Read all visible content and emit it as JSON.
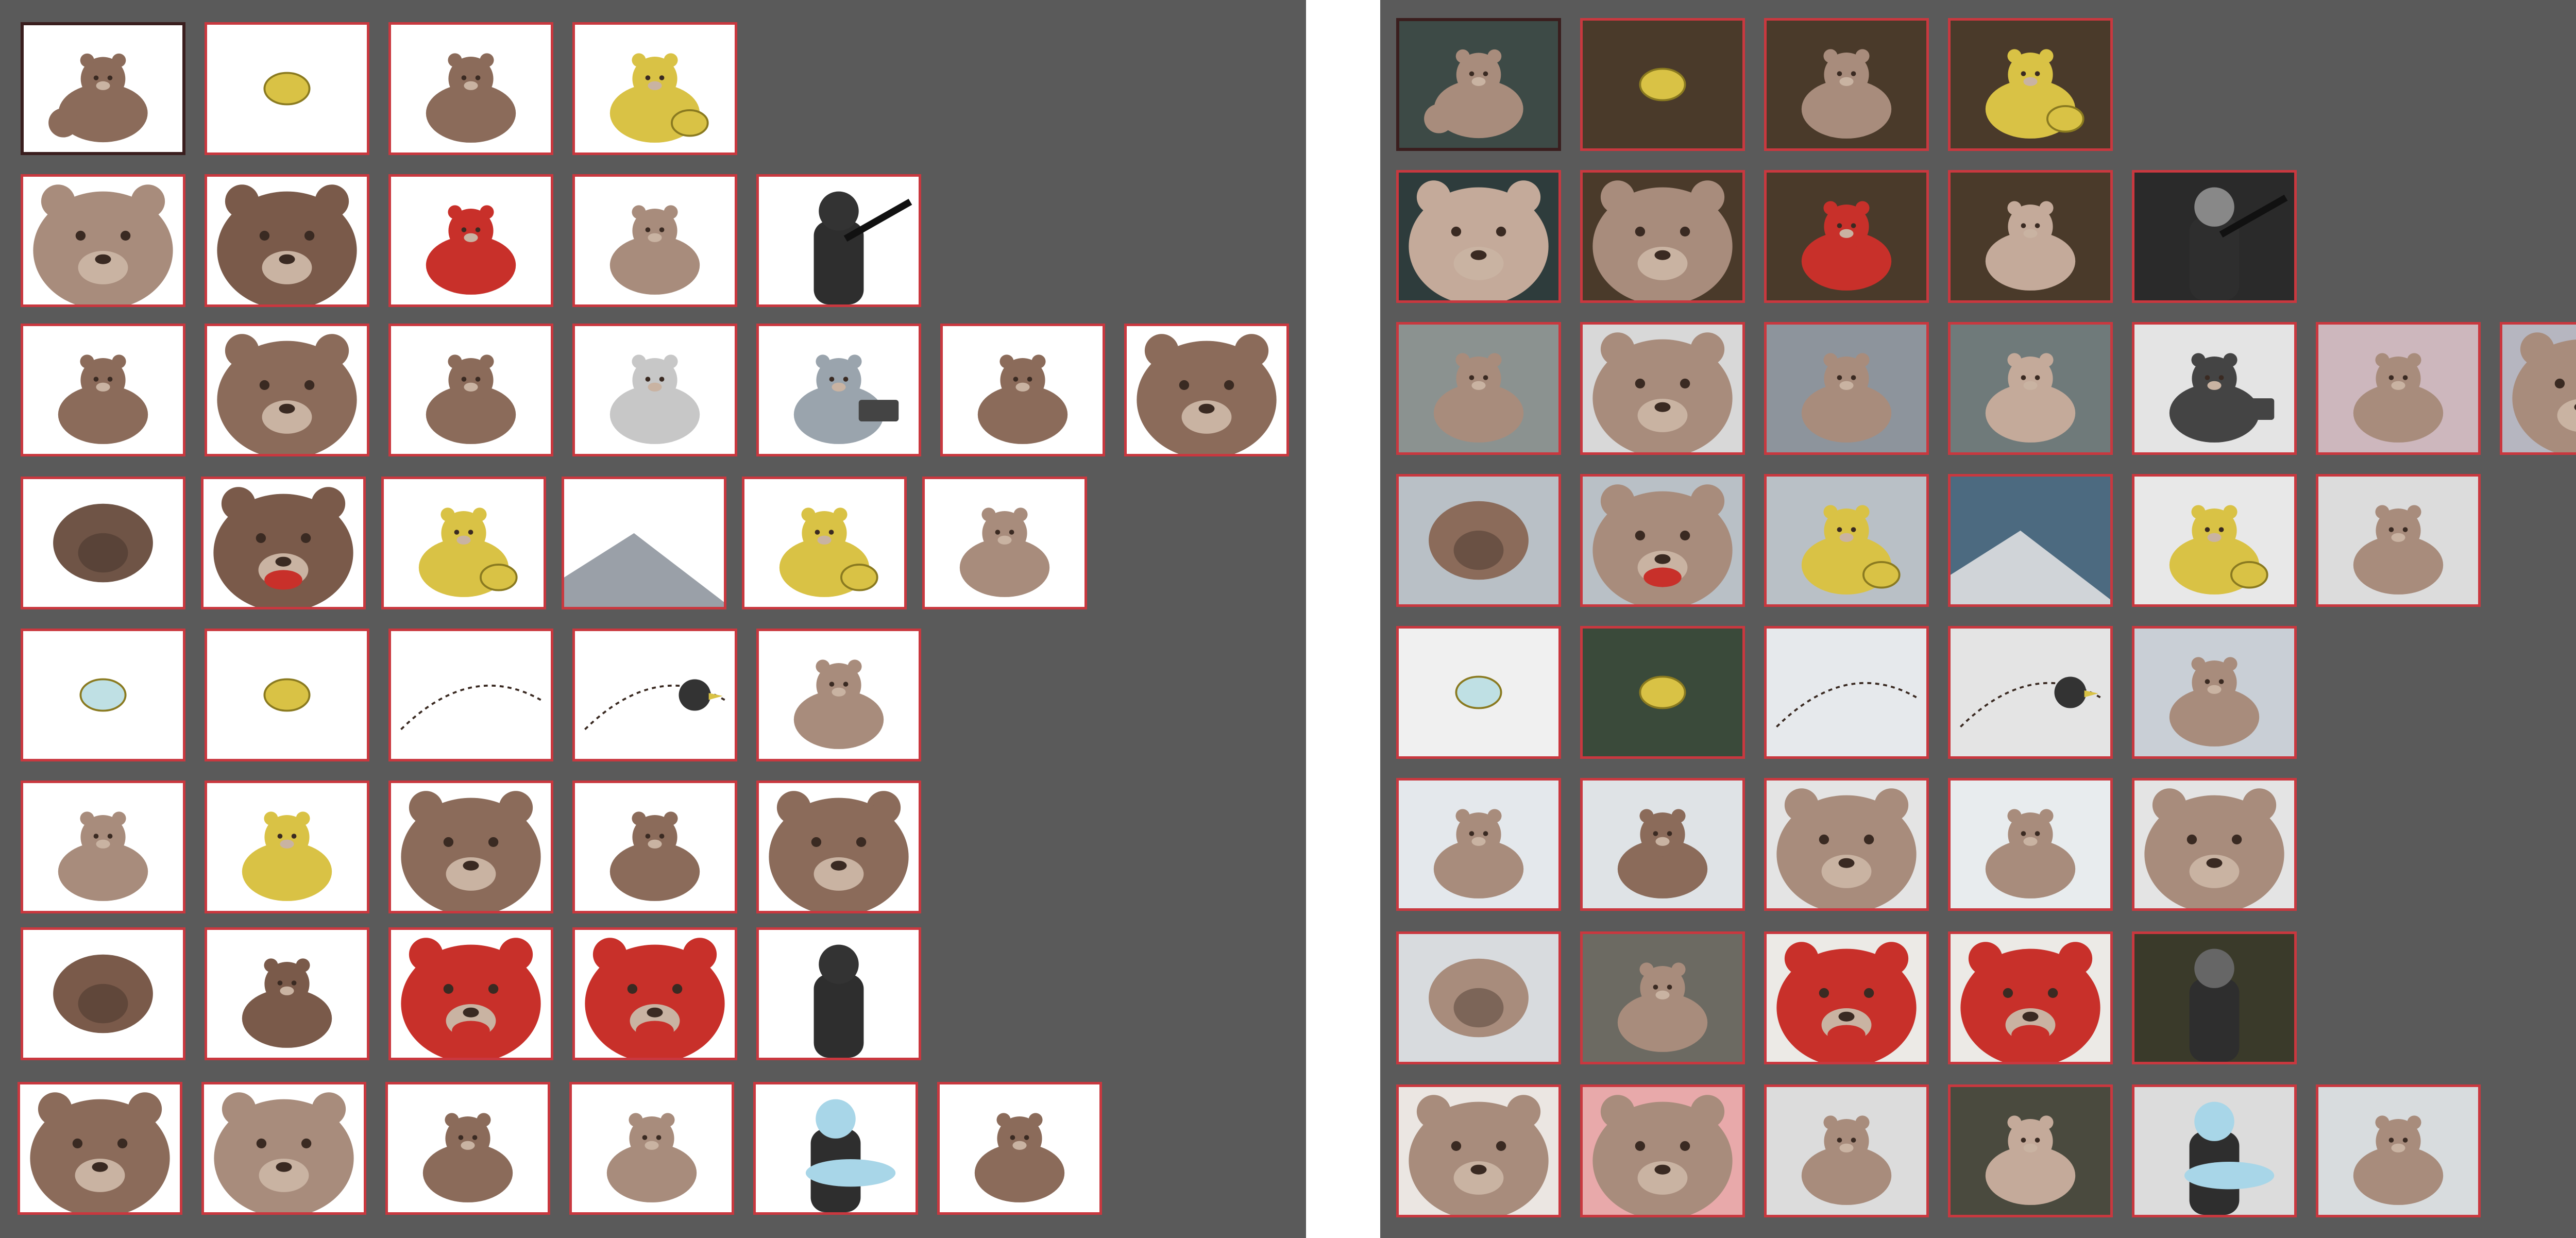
{
  "panels": [
    {
      "id": "storyboard-left",
      "selected_frame": "1-1",
      "rows": [
        [
          {
            "icon": "bear-and-cub-icon",
            "bg": "#ffffff",
            "accent": "#8b6b5a"
          },
          {
            "icon": "squirrel-and-honey-icon",
            "bg": "#ffffff",
            "accent": "#d9c245"
          },
          {
            "icon": "bear-walking-icon",
            "bg": "#ffffff",
            "accent": "#8b6b5a"
          },
          {
            "icon": "bear-eating-honey-icon",
            "bg": "#ffffff",
            "accent": "#d9c245"
          }
        ],
        [
          {
            "icon": "worried-bear-face-icon",
            "bg": "#ffffff",
            "accent": "#a88c7c"
          },
          {
            "icon": "angry-bear-eyes-icon",
            "bg": "#ffffff",
            "accent": "#7a5a4a"
          },
          {
            "icon": "injured-bear-icon",
            "bg": "#ffffff",
            "accent": "#c8302a"
          },
          {
            "icon": "bears-fighting-icon",
            "bg": "#ffffff",
            "accent": "#a88c7c"
          },
          {
            "icon": "hunter-with-rifle-icon",
            "bg": "#ffffff",
            "accent": "#333333"
          }
        ],
        [
          {
            "icon": "roaring-bear-icon",
            "bg": "#ffffff",
            "accent": "#8b6b5a"
          },
          {
            "icon": "bear-head-closeup-icon",
            "bg": "#ffffff",
            "accent": "#8b6b5a"
          },
          {
            "icon": "shocked-bear-icon",
            "bg": "#ffffff",
            "accent": "#8b6b5a"
          },
          {
            "icon": "bear-on-slope-icon",
            "bg": "#ffffff",
            "accent": "#c7c7c7"
          },
          {
            "icon": "bear-and-truck-icon",
            "bg": "#ffffff",
            "accent": "#9aa4ad"
          },
          {
            "icon": "small-bear-in-snow-icon",
            "bg": "#ffffff",
            "accent": "#8b6b5a"
          },
          {
            "icon": "grumpy-bear-face-icon",
            "bg": "#ffffff",
            "accent": "#8b6b5a"
          }
        ],
        [
          {
            "icon": "bear-paw-icon",
            "bg": "#ffffff",
            "accent": "#6f5446"
          },
          {
            "icon": "bear-teeth-icon",
            "bg": "#ffffff",
            "accent": "#7a5a4a"
          },
          {
            "icon": "bear-holding-honey-icon",
            "bg": "#ffffff",
            "accent": "#d9c245"
          },
          {
            "icon": "mountain-slope-icon",
            "bg": "#ffffff",
            "accent": "#9aa0a8"
          },
          {
            "icon": "bear-with-honey-icon",
            "bg": "#ffffff",
            "accent": "#d9c245"
          },
          {
            "icon": "bear-on-rock-icon",
            "bg": "#ffffff",
            "accent": "#a88c7c"
          }
        ],
        [
          {
            "icon": "paw-with-honey-icon",
            "bg": "#ffffff",
            "accent": "#bfe0e4"
          },
          {
            "icon": "honey-falling-icon",
            "bg": "#ffffff",
            "accent": "#d9c245"
          },
          {
            "icon": "dotted-arc-icon",
            "bg": "#ffffff",
            "accent": "#444444"
          },
          {
            "icon": "bird-flying-icon",
            "bg": "#ffffff",
            "accent": "#333333"
          },
          {
            "icon": "bear-arms-crossed-icon",
            "bg": "#ffffff",
            "accent": "#a88c7c"
          }
        ],
        [
          {
            "icon": "bear-dancing-icon",
            "bg": "#ffffff",
            "accent": "#a88c7c"
          },
          {
            "icon": "claw-strike-icon",
            "bg": "#ffffff",
            "accent": "#d9c245"
          },
          {
            "icon": "bear-growling-icon",
            "bg": "#ffffff",
            "accent": "#8b6b5a"
          },
          {
            "icon": "tiny-bear-icon",
            "bg": "#ffffff",
            "accent": "#8b6b5a"
          },
          {
            "icon": "crying-bear-icon",
            "bg": "#ffffff",
            "accent": "#8b6b5a"
          }
        ],
        [
          {
            "icon": "bear-paws-stomp-icon",
            "bg": "#ffffff",
            "accent": "#7a5a4a"
          },
          {
            "icon": "bear-standing-roar-icon",
            "bg": "#ffffff",
            "accent": "#7a5a4a"
          },
          {
            "icon": "bear-open-mouth-icon",
            "bg": "#ffffff",
            "accent": "#c8302a"
          },
          {
            "icon": "bear-side-roar-icon",
            "bg": "#ffffff",
            "accent": "#c8302a"
          },
          {
            "icon": "hooded-figure-icon",
            "bg": "#ffffff",
            "accent": "#333333"
          }
        ],
        [
          {
            "icon": "bear-peeking-icon",
            "bg": "#ffffff",
            "accent": "#8b6b5a"
          },
          {
            "icon": "bear-covering-eye-icon",
            "bg": "#ffffff",
            "accent": "#a88c7c"
          },
          {
            "icon": "bear-cheering-icon",
            "bg": "#ffffff",
            "accent": "#8b6b5a"
          },
          {
            "icon": "bear-walking-away-icon",
            "bg": "#ffffff",
            "accent": "#a88c7c"
          },
          {
            "icon": "figure-with-fish-icon",
            "bg": "#ffffff",
            "accent": "#a8d6e8"
          },
          {
            "icon": "bear-back-view-icon",
            "bg": "#ffffff",
            "accent": "#8b6b5a"
          }
        ]
      ]
    },
    {
      "id": "storyboard-right",
      "selected_frame": "1-1",
      "rows": [
        [
          {
            "icon": "bear-and-cub-icon",
            "bg": "#3d4a46",
            "accent": "#a88c7c"
          },
          {
            "icon": "squirrel-and-honey-icon",
            "bg": "#4a3a2a",
            "accent": "#d9c245"
          },
          {
            "icon": "bear-walking-icon",
            "bg": "#4a3a2a",
            "accent": "#a88c7c"
          },
          {
            "icon": "bear-eating-honey-icon",
            "bg": "#4a3a2a",
            "accent": "#d9c245"
          }
        ],
        [
          {
            "icon": "worried-bear-face-icon",
            "bg": "#2e3c3c",
            "accent": "#c4aa9a"
          },
          {
            "icon": "angry-bear-eyes-icon",
            "bg": "#4a3a2a",
            "accent": "#a88c7c"
          },
          {
            "icon": "injured-bear-icon",
            "bg": "#4a3a2a",
            "accent": "#c8302a"
          },
          {
            "icon": "bears-fighting-icon",
            "bg": "#4a3a2a",
            "accent": "#c4aa9a"
          },
          {
            "icon": "hunter-with-rifle-icon",
            "bg": "#2a2a2a",
            "accent": "#888888"
          }
        ],
        [
          {
            "icon": "roaring-bear-icon",
            "bg": "#8b9290",
            "accent": "#a88c7c"
          },
          {
            "icon": "bear-head-closeup-icon",
            "bg": "#d8d8d8",
            "accent": "#a88c7c"
          },
          {
            "icon": "shocked-bear-icon",
            "bg": "#8d949c",
            "accent": "#a88c7c"
          },
          {
            "icon": "bear-on-slope-icon",
            "bg": "#6f7a7a",
            "accent": "#c4aa9a"
          },
          {
            "icon": "bear-and-truck-icon",
            "bg": "#e4e4e4",
            "accent": "#444444"
          },
          {
            "icon": "small-bear-in-snow-icon",
            "bg": "#cdb7bd",
            "accent": "#a88c7c"
          },
          {
            "icon": "grumpy-bear-face-icon",
            "bg": "#b6b6c0",
            "accent": "#a88c7c"
          }
        ],
        [
          {
            "icon": "bear-paw-icon",
            "bg": "#b9c0c6",
            "accent": "#8b6b5a"
          },
          {
            "icon": "bear-teeth-icon",
            "bg": "#b9c0c6",
            "accent": "#a88c7c"
          },
          {
            "icon": "bear-holding-honey-icon",
            "bg": "#b9c0c6",
            "accent": "#d9c245"
          },
          {
            "icon": "mountain-slope-icon",
            "bg": "#4c6a80",
            "accent": "#d0d4d8"
          },
          {
            "icon": "bear-with-honey-icon",
            "bg": "#e8e8e8",
            "accent": "#d9c245"
          },
          {
            "icon": "bear-on-rock-icon",
            "bg": "#dcdcdc",
            "accent": "#a88c7c"
          }
        ],
        [
          {
            "icon": "paw-with-honey-icon",
            "bg": "#f0f0f0",
            "accent": "#bfe0e4"
          },
          {
            "icon": "honey-falling-icon",
            "bg": "#3a4a3a",
            "accent": "#d9c245"
          },
          {
            "icon": "dotted-arc-icon",
            "bg": "#e6e9ec",
            "accent": "#9aa4ad"
          },
          {
            "icon": "bird-flying-icon",
            "bg": "#e4e4e4",
            "accent": "#333333"
          },
          {
            "icon": "bear-arms-crossed-icon",
            "bg": "#c9cfd6",
            "accent": "#a88c7c"
          }
        ],
        [
          {
            "icon": "bear-dancing-icon",
            "bg": "#e4e8ec",
            "accent": "#a88c7c"
          },
          {
            "icon": "claw-strike-icon",
            "bg": "#dfe3e6",
            "accent": "#8b6b5a"
          },
          {
            "icon": "bear-growling-icon",
            "bg": "#e4e4e4",
            "accent": "#a88c7c"
          },
          {
            "icon": "tiny-bear-icon",
            "bg": "#e8ecee",
            "accent": "#a88c7c"
          },
          {
            "icon": "crying-bear-icon",
            "bg": "#e4e4e4",
            "accent": "#a88c7c"
          }
        ],
        [
          {
            "icon": "bear-paws-stomp-icon",
            "bg": "#d8dbde",
            "accent": "#a88c7c"
          },
          {
            "icon": "bear-standing-roar-icon",
            "bg": "#6c6a62",
            "accent": "#a88c7c"
          },
          {
            "icon": "bear-open-mouth-icon",
            "bg": "#eceae6",
            "accent": "#c8302a"
          },
          {
            "icon": "bear-side-roar-icon",
            "bg": "#eceae6",
            "accent": "#c8302a"
          },
          {
            "icon": "hooded-figure-icon",
            "bg": "#3a3a2a",
            "accent": "#666666"
          }
        ],
        [
          {
            "icon": "bear-peeking-icon",
            "bg": "#ebe6e2",
            "accent": "#a88c7c"
          },
          {
            "icon": "bear-covering-eye-icon",
            "bg": "#e8a9aa",
            "accent": "#a88c7c"
          },
          {
            "icon": "bear-cheering-icon",
            "bg": "#dcdcdc",
            "accent": "#a88c7c"
          },
          {
            "icon": "bear-walking-away-icon",
            "bg": "#4a4a3e",
            "accent": "#c4aa9a"
          },
          {
            "icon": "figure-with-fish-icon",
            "bg": "#dcdcdc",
            "accent": "#a8d6e8"
          },
          {
            "icon": "bear-back-view-icon",
            "bg": "#d8dcde",
            "accent": "#a88c7c"
          }
        ]
      ]
    }
  ]
}
